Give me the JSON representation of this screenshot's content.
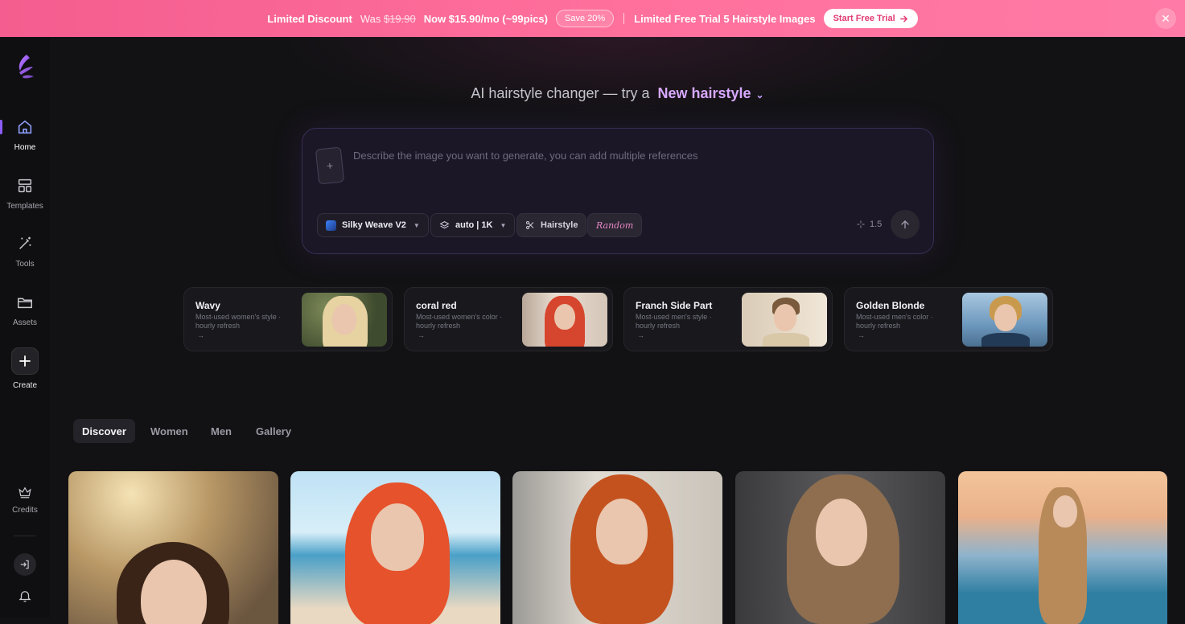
{
  "banner": {
    "limited_discount": "Limited Discount",
    "was_label": "Was",
    "was_price": "$19.90",
    "now_price": "Now $15.90/mo (~99pics)",
    "save_badge": "Save 20%",
    "trial_text": "Limited Free Trial 5 Hairstyle Images",
    "cta_label": "Start Free Trial",
    "close_glyph": "✕"
  },
  "sidebar": {
    "items": [
      {
        "label": "Home",
        "icon": "home-icon"
      },
      {
        "label": "Templates",
        "icon": "templates-icon"
      },
      {
        "label": "Tools",
        "icon": "magic-wand-icon"
      },
      {
        "label": "Assets",
        "icon": "folder-icon"
      },
      {
        "label": "Create",
        "icon": "plus-icon"
      },
      {
        "label": "Credits",
        "icon": "crown-icon"
      }
    ]
  },
  "hero": {
    "prefix": "AI hairstyle changer — try a",
    "accent": "New hairstyle"
  },
  "prompt": {
    "placeholder": "Describe the image you want to generate, you can add multiple references",
    "model_label": "Silky Weave V2",
    "size_label": "auto | 1K",
    "hairstyle_label": "Hairstyle",
    "random_label": "Random",
    "cost": "1.5"
  },
  "featured": [
    {
      "title": "Wavy",
      "subtitle": "Most-used women's style · hourly refresh"
    },
    {
      "title": "coral red",
      "subtitle": "Most-used women's color · hourly refresh"
    },
    {
      "title": "Franch Side Part",
      "subtitle": "Most-used men's style · hourly refresh"
    },
    {
      "title": "Golden Blonde",
      "subtitle": "Most-used men's color · hourly refresh"
    }
  ],
  "tabs": [
    "Discover",
    "Women",
    "Men",
    "Gallery"
  ],
  "colors": {
    "banner_start": "#f35d8f",
    "banner_end": "#ff7aa6",
    "accent_purple": "#d7a8ff",
    "background": "#121214"
  }
}
